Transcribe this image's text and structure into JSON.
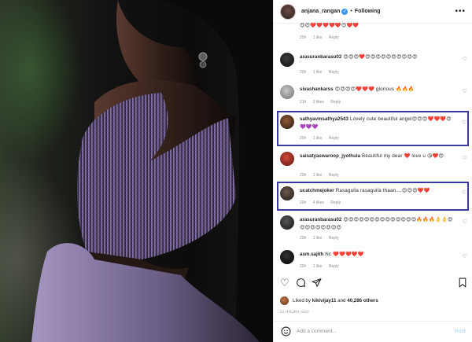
{
  "post": {
    "username": "anjana_rangan",
    "verified_icon": "verified-badge-icon",
    "follow_label": "Following",
    "more_icon": "more-horizontal-icon"
  },
  "comments": [
    {
      "username": "",
      "text": "😍😍❤️❤️❤️❤️❤️😍❤️❤️",
      "time": "20h",
      "likes": "1 like",
      "reply": "Reply"
    },
    {
      "username": "arasuranbarasu02",
      "text": "😍😍😍❤️😍😍😍😍😍😍😍😍😍😍",
      "time": "20h",
      "likes": "1 like",
      "reply": "Reply"
    },
    {
      "username": "sivashankarss",
      "text": "😍😍😍😍❤️❤️❤️ glorious 🔥🔥🔥",
      "time": "21h",
      "likes": "2 likes",
      "reply": "Reply"
    },
    {
      "username": "sathyavmsathya2543",
      "text": "Lovely cute beautiful angel😍😍😍❤️❤️❤️😍💜💜💜",
      "time": "20h",
      "likes": "1 like",
      "reply": "Reply"
    },
    {
      "username": "saisatyaswaroop_jyothula",
      "text": "Beautiful my dear ❤️ love u 😘❤️😍",
      "time": "20h",
      "likes": "1 like",
      "reply": "Reply"
    },
    {
      "username": "ucatchmejoker",
      "text": "Rasagulla rasagulla thaan....😍😍😍❤️❤️",
      "time": "20h",
      "likes": "4 likes",
      "reply": "Reply"
    },
    {
      "username": "arasuranbarasu02",
      "text": "😍😍😍😍😍😍😍😍😍😍😍😍😍😍🔥🔥🔥👌👌😍😍😍😍😍😍😍😍😍",
      "time": "20h",
      "likes": "1 like",
      "reply": "Reply"
    },
    {
      "username": "asm.sajith",
      "text": "Nc ❤️❤️❤️❤️❤️",
      "time": "20h",
      "likes": "1 like",
      "reply": "Reply"
    }
  ],
  "actions": {
    "like_icon": "heart-outline-icon",
    "comment_icon": "comment-icon",
    "share_icon": "paper-plane-icon",
    "save_icon": "bookmark-icon"
  },
  "likes": {
    "prefix": "Liked by",
    "user": "kikivijay11",
    "conj": "and",
    "others": "40,286 others"
  },
  "timestamp": "21 HOURS AGO",
  "add_comment": {
    "emoji_icon": "smiley-icon",
    "placeholder": "Add a comment...",
    "post_label": "Post"
  },
  "colors": {
    "highlight_border": "#3a3aa0",
    "post_disabled": "#b3dbff",
    "meta_gray": "#8e8e8e"
  }
}
